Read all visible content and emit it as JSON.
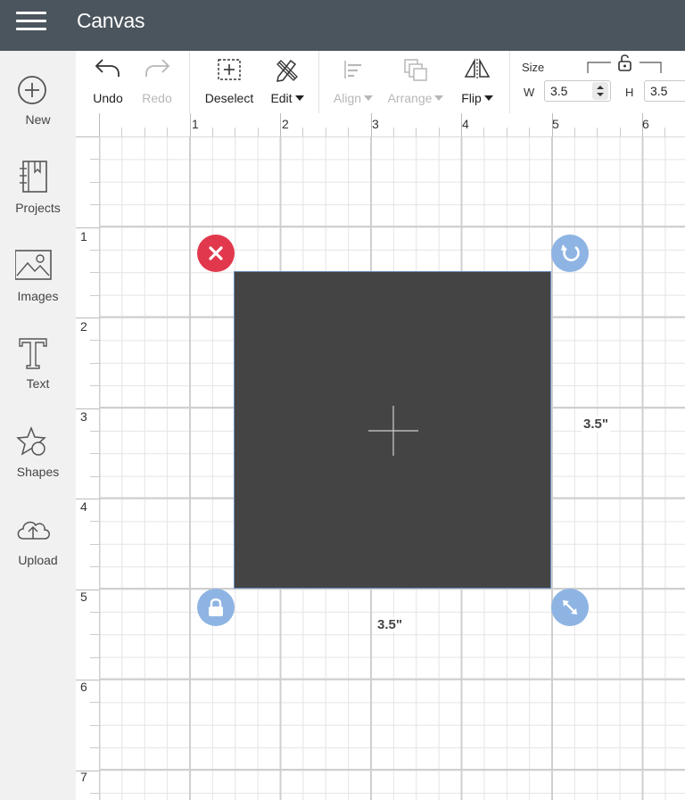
{
  "app": {
    "title": "Canvas"
  },
  "sidebar": {
    "items": [
      {
        "label": "New",
        "icon": "plus-circle-icon"
      },
      {
        "label": "Projects",
        "icon": "projects-book-icon"
      },
      {
        "label": "Images",
        "icon": "image-icon"
      },
      {
        "label": "Text",
        "icon": "text-t-icon"
      },
      {
        "label": "Shapes",
        "icon": "shapes-icon"
      },
      {
        "label": "Upload",
        "icon": "cloud-upload-icon"
      }
    ]
  },
  "toolbar": {
    "undo_label": "Undo",
    "redo_label": "Redo",
    "deselect_label": "Deselect",
    "edit_label": "Edit",
    "align_label": "Align",
    "arrange_label": "Arrange",
    "flip_label": "Flip",
    "size_label": "Size",
    "w_label": "W",
    "h_label": "H",
    "width_value": "3.5",
    "height_value": "3.5"
  },
  "rulers": {
    "top": [
      "1",
      "2",
      "3",
      "4",
      "5",
      "6"
    ],
    "left": [
      "1",
      "2",
      "3",
      "4",
      "5",
      "6",
      "7"
    ]
  },
  "selection": {
    "width_label": "3.5\"",
    "height_label": "3.5\""
  },
  "colors": {
    "topbar": "#4b555d",
    "shape_fill": "#444444",
    "delete_handle": "#e2384d",
    "control_handle": "#8eb4e3"
  }
}
